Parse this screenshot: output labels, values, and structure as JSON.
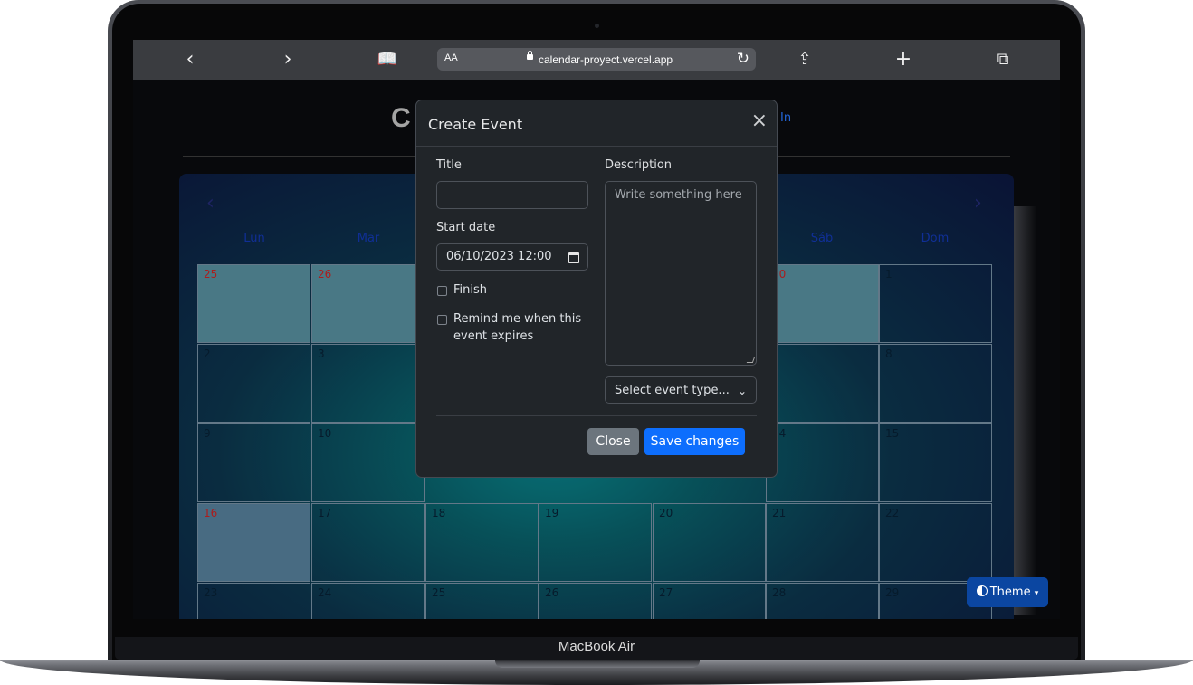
{
  "browser": {
    "text_size_label": "AA",
    "url": "calendar-proyect.vercel.app"
  },
  "app": {
    "title_partial": "C",
    "sign_in_partial": "In"
  },
  "calendar": {
    "weekdays": [
      "Lun",
      "Mar",
      "Sáb",
      "Dom"
    ],
    "days_visible": [
      "25",
      "26",
      "30",
      "1",
      "2",
      "3",
      "7",
      "8",
      "9",
      "10",
      "14",
      "15",
      "16",
      "17",
      "18",
      "19",
      "20",
      "21",
      "22",
      "23",
      "24",
      "25",
      "26",
      "27",
      "28",
      "29"
    ]
  },
  "modal": {
    "title": "Create Event",
    "title_label": "Title",
    "title_value": "",
    "start_date_label": "Start date",
    "start_date_value": "06/10/2023 12:00",
    "finish_label": "Finish",
    "remind_label_line1": "Remind me when this",
    "remind_label_line2": "event expires",
    "description_label": "Description",
    "description_placeholder": "Write something here",
    "event_type_selected": "Select event type...",
    "close_button": "Close",
    "save_button": "Save changes"
  },
  "theme_button": "Theme",
  "device_label": "MacBook Air",
  "colors": {
    "primary": "#0d6efd",
    "secondary": "#6c757d",
    "modal_bg": "#212529",
    "theme_button": "#0b46a1",
    "highlight_day": "#4b7b88"
  },
  "icons": [
    "back-icon",
    "forward-icon",
    "bookmarks-icon",
    "lock-icon",
    "reload-icon",
    "share-icon",
    "new-tab-icon",
    "tabs-icon",
    "close-icon",
    "calendar-icon",
    "chevron-down-icon",
    "theme-half-circle-icon"
  ]
}
